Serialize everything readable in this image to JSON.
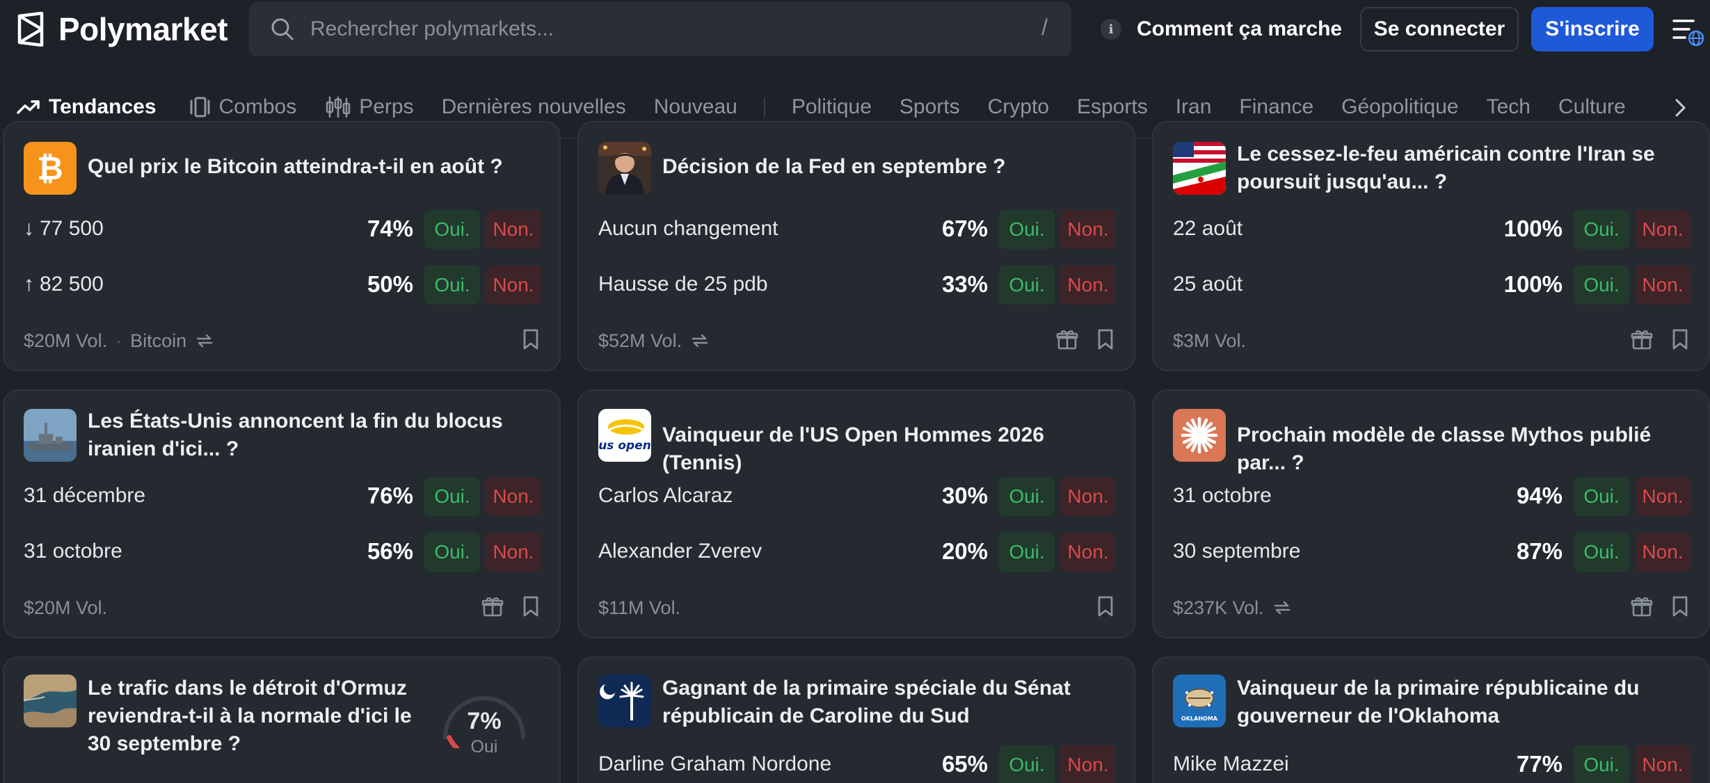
{
  "header": {
    "brand": "Polymarket",
    "search_placeholder": "Rechercher polymarkets...",
    "search_shortcut": "/",
    "how_it_works": "Comment ça marche",
    "login": "Se connecter",
    "signup": "S'inscrire"
  },
  "nav": {
    "trending": "Tendances",
    "combos": "Combos",
    "perps": "Perps",
    "items": [
      "Dernières nouvelles",
      "Nouveau"
    ],
    "categories": [
      "Politique",
      "Sports",
      "Crypto",
      "Esports",
      "Iran",
      "Finance",
      "Géopolitique",
      "Tech",
      "Culture"
    ]
  },
  "cards": [
    {
      "title": "Quel prix le Bitcoin atteindra-t-il en août ?",
      "icon": "bitcoin-icon",
      "rows": [
        {
          "label": "77 500",
          "arrow": "↓",
          "pct": "74%",
          "yes": "Oui.",
          "no": "Non."
        },
        {
          "label": "82 500",
          "arrow": "↑",
          "pct": "50%",
          "yes": "Oui.",
          "no": "Non."
        }
      ],
      "volume": "$20M Vol.",
      "tag": "Bitcoin"
    },
    {
      "title": "Décision de la Fed en septembre ?",
      "icon": "fed-chair-portrait",
      "rows": [
        {
          "label": "Aucun changement",
          "pct": "67%",
          "yes": "Oui.",
          "no": "Non."
        },
        {
          "label": "Hausse de 25 pdb",
          "pct": "33%",
          "yes": "Oui.",
          "no": "Non."
        }
      ],
      "volume": "$52M Vol."
    },
    {
      "title": "Le cessez-le-feu américain contre l'Iran se poursuit jusqu'au... ?",
      "icon": "us-iran-flags",
      "rows": [
        {
          "label": "22 août",
          "pct": "100%",
          "yes": "Oui.",
          "no": "Non."
        },
        {
          "label": "25 août",
          "pct": "100%",
          "yes": "Oui.",
          "no": "Non."
        }
      ],
      "volume": "$3M Vol."
    },
    {
      "title": "Les États-Unis annoncent la fin du blocus iranien d'ici... ?",
      "icon": "warship-photo",
      "rows": [
        {
          "label": "31 décembre",
          "pct": "76%",
          "yes": "Oui.",
          "no": "Non."
        },
        {
          "label": "31 octobre",
          "pct": "56%",
          "yes": "Oui.",
          "no": "Non."
        }
      ],
      "volume": "$20M Vol."
    },
    {
      "title": "Vainqueur de l'US Open Hommes 2026 (Tennis)",
      "icon": "us-open-logo",
      "icon_text": "us open",
      "rows": [
        {
          "label": "Carlos Alcaraz",
          "pct": "30%",
          "yes": "Oui.",
          "no": "Non."
        },
        {
          "label": "Alexander Zverev",
          "pct": "20%",
          "yes": "Oui.",
          "no": "Non."
        }
      ],
      "volume": "$11M Vol."
    },
    {
      "title": "Prochain modèle de classe Mythos publié par... ?",
      "icon": "anthropic-burst-icon",
      "rows": [
        {
          "label": "31 octobre",
          "pct": "94%",
          "yes": "Oui.",
          "no": "Non."
        },
        {
          "label": "30 septembre",
          "pct": "87%",
          "yes": "Oui.",
          "no": "Non."
        }
      ],
      "volume": "$237K Vol."
    },
    {
      "title": "Le trafic dans le détroit d'Ormuz reviendra-t-il à la normale d'ici le 30 septembre ?",
      "icon": "strait-satellite-photo",
      "gauge_value": 0.07,
      "gauge_pct": "7%",
      "gauge_label": "Oui"
    },
    {
      "title": "Gagnant de la primaire spéciale du Sénat républicain de Caroline du Sud",
      "icon": "south-carolina-flag",
      "rows": [
        {
          "label": "Darline Graham Nordone",
          "pct": "65%",
          "yes": "Oui.",
          "no": "Non."
        }
      ]
    },
    {
      "title": "Vainqueur de la primaire républicaine du gouverneur de l'Oklahoma",
      "icon": "oklahoma-flag",
      "icon_text": "OKLAHOMA",
      "rows": [
        {
          "label": "Mike Mazzei",
          "pct": "77%",
          "yes": "Oui.",
          "no": "Non."
        }
      ]
    }
  ],
  "colors": {
    "background": "#1d2128",
    "card": "#252a31",
    "accent": "#1e59d8",
    "yes_text": "#3dba6a",
    "yes_bg": "#213a2c",
    "no_text": "#d94a4a",
    "no_bg": "#3d2428"
  }
}
